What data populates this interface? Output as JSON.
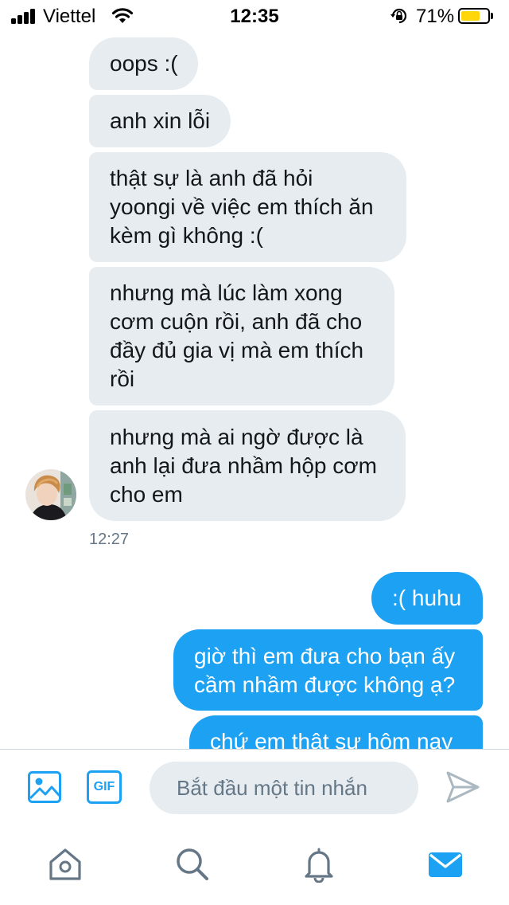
{
  "status_bar": {
    "carrier": "Viettel",
    "time": "12:35",
    "battery_percent": "71%",
    "battery_level": 0.71,
    "battery_color": "#ffd60a",
    "icons": [
      "signal-icon",
      "wifi-icon",
      "rotation-lock-icon",
      "battery-icon"
    ]
  },
  "conversation": {
    "incoming": [
      {
        "lines": [
          "oops :("
        ]
      },
      {
        "lines": [
          "anh xin lỗi"
        ]
      },
      {
        "lines": [
          "thật sự là anh đã hỏi",
          "yoongi về việc em thích ăn",
          "kèm gì không :("
        ]
      },
      {
        "lines": [
          "nhưng mà lúc làm xong",
          "cơm cuộn rồi, anh đã cho",
          "đầy đủ gia vị mà em thích",
          "rồi"
        ]
      },
      {
        "lines": [
          "nhưng mà ai ngờ được là",
          "anh lại đưa nhầm hộp cơm",
          "cho em"
        ]
      }
    ],
    "incoming_timestamp": "12:27",
    "outgoing": [
      {
        "lines": [
          ":( huhu"
        ]
      },
      {
        "lines": [
          "giờ thì em đưa cho bạn ấy",
          "cầm nhầm được không ạ?"
        ]
      },
      {
        "lines": [
          "chứ em thật sự hôm nay"
        ]
      }
    ]
  },
  "composer": {
    "gif_label": "GIF",
    "placeholder": "Bắt đầu một tin nhắn",
    "icons": [
      "image-icon",
      "gif-icon",
      "send-icon"
    ]
  },
  "tab_bar": {
    "icons": [
      "home-icon",
      "search-icon",
      "notifications-icon",
      "messages-icon"
    ],
    "active": "messages"
  },
  "colors": {
    "accent": "#1da1f2",
    "incoming_bubble": "#e6ecf0",
    "inactive_icon": "#657786"
  }
}
